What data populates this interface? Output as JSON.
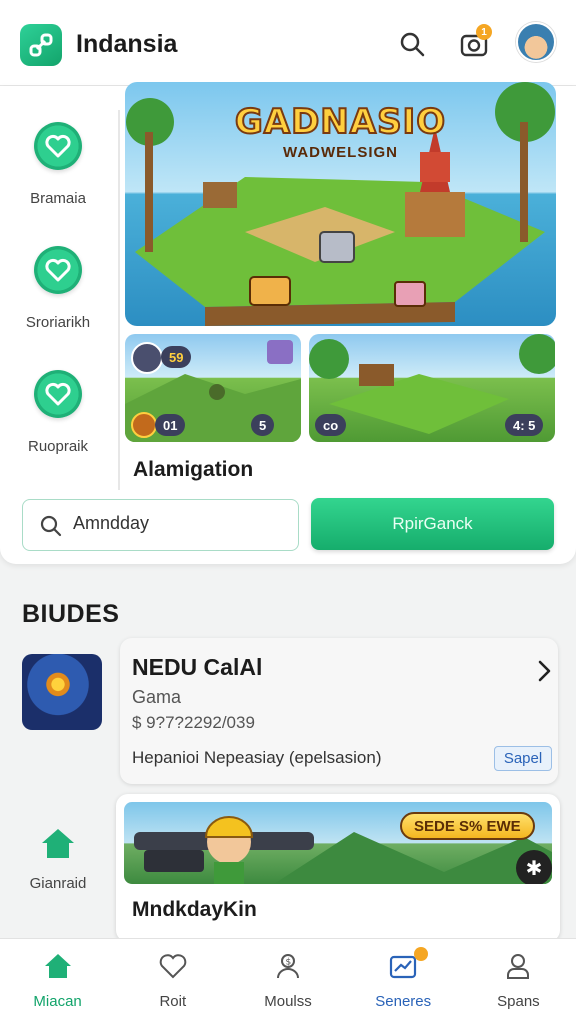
{
  "header": {
    "title": "Indansia",
    "notification_count": "1"
  },
  "sidebar": {
    "items": [
      {
        "label": "Bramaia",
        "icon": "heart-badge-icon"
      },
      {
        "label": "Sroriarikh",
        "icon": "heart-badge-icon"
      },
      {
        "label": "Ruopraik",
        "icon": "heart-badge-icon"
      },
      {
        "label": "Gianraid",
        "icon": "home-icon"
      }
    ]
  },
  "hero": {
    "title": "GADNASIO",
    "subtitle": "WADWELSIGN"
  },
  "thumbnails": [
    {
      "stat_top": "59",
      "stat_bottom": "01",
      "stat_right": "5"
    },
    {
      "stat_bottom": "co",
      "stat_right": "4: 5"
    }
  ],
  "feature": {
    "title": "Alamigation"
  },
  "search": {
    "value": "Amndday",
    "button_label": "RpirGanck"
  },
  "section": {
    "title": "BIUDES"
  },
  "list_item": {
    "name": "NEDU CalAl",
    "category": "Gama",
    "price": "$ 9?7?2292/039",
    "description": "Hepanioi Nepeasiay  (epelsasion)",
    "tag": "Sapel"
  },
  "promo": {
    "tag": "SEDE S% EWE",
    "title": "MndkdayKin",
    "action_icon": "asterisk-icon"
  },
  "tabbar": {
    "tabs": [
      {
        "label": "Miacan",
        "icon": "home-icon",
        "active": true
      },
      {
        "label": "Roit",
        "icon": "heart-outline-icon"
      },
      {
        "label": "Moulss",
        "icon": "user-money-icon"
      },
      {
        "label": "Seneres",
        "icon": "chart-card-icon"
      },
      {
        "label": "Spans",
        "icon": "person-icon"
      }
    ]
  },
  "colors": {
    "accent": "#16ad6c",
    "tab_blue": "#2a63b8",
    "notification": "#f5a623"
  }
}
